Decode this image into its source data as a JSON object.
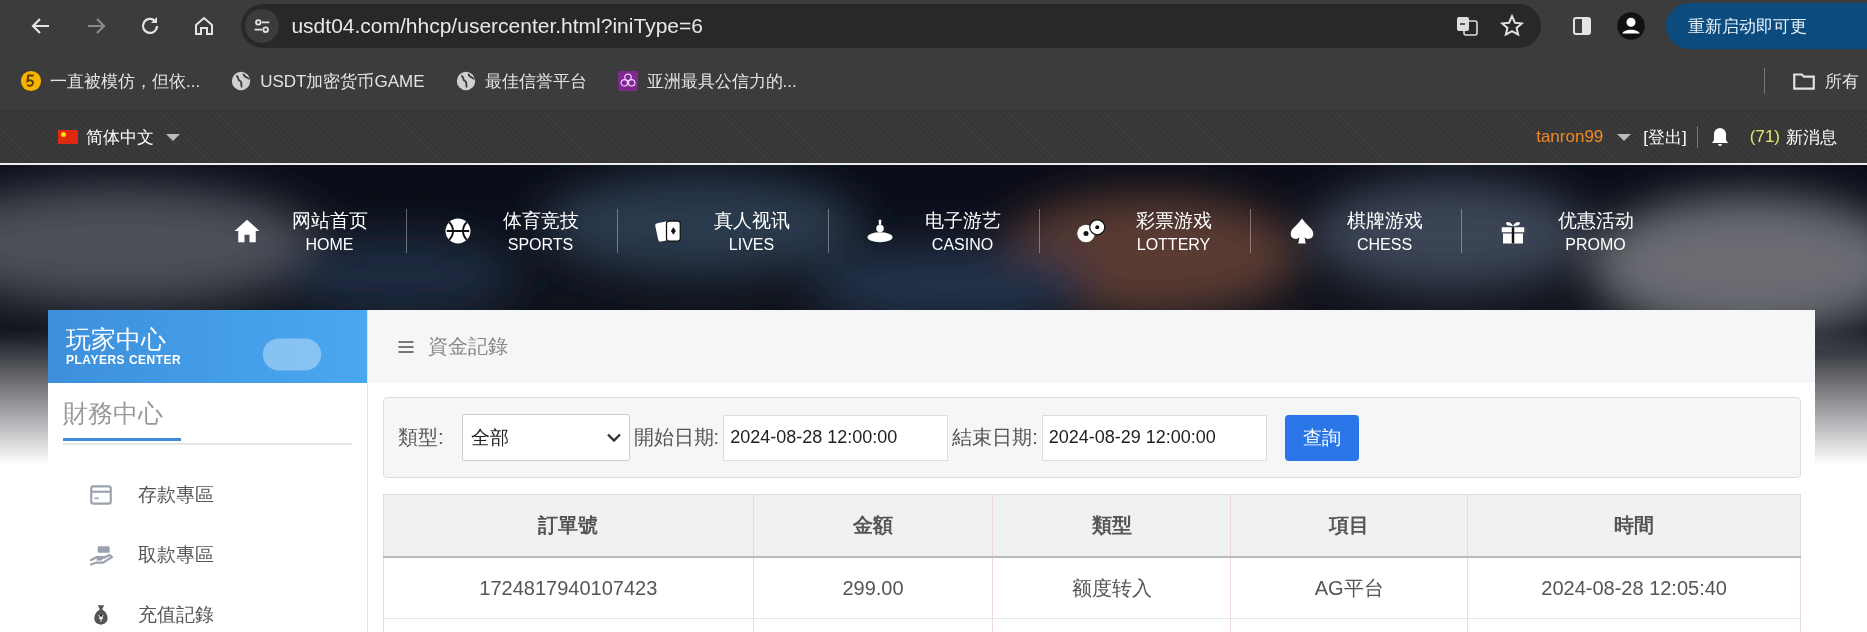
{
  "browser": {
    "url": "usdt04.com/hhcp/usercenter.html?iniType=6",
    "update_button": "重新启动即可更",
    "bookmarks": [
      {
        "label": "一直被模仿，但依..."
      },
      {
        "label": "USDT加密货币GAME"
      },
      {
        "label": "最佳信誉平台"
      },
      {
        "label": "亚洲最具公信力的..."
      }
    ],
    "bookmarks_folder": "所有"
  },
  "top_bar": {
    "language": "简体中文",
    "username": "tanron99",
    "logout": "[登出]",
    "message_count": "(71)",
    "messages": "新消息"
  },
  "nav": [
    {
      "title": "网站首页",
      "subtitle": "HOME"
    },
    {
      "title": "体育竞技",
      "subtitle": "SPORTS"
    },
    {
      "title": "真人视讯",
      "subtitle": "LIVES"
    },
    {
      "title": "电子游艺",
      "subtitle": "CASINO"
    },
    {
      "title": "彩票游戏",
      "subtitle": "LOTTERY"
    },
    {
      "title": "棋牌游戏",
      "subtitle": "CHESS"
    },
    {
      "title": "优惠活动",
      "subtitle": "PROMO"
    }
  ],
  "sidebar": {
    "title": "玩家中心",
    "subtitle": "PLAYERS CENTER",
    "section": "財務中心",
    "items": [
      {
        "label": "存款專區"
      },
      {
        "label": "取款專區"
      },
      {
        "label": "充值記錄"
      }
    ]
  },
  "content": {
    "breadcrumb": "資金記錄",
    "filter": {
      "type_label": "類型:",
      "type_value": "全部",
      "start_label": "開始日期:",
      "start_value": "2024-08-28 12:00:00",
      "end_label": "結束日期:",
      "end_value": "2024-08-29 12:00:00",
      "button": "查詢"
    },
    "table": {
      "columns": [
        "訂單號",
        "金額",
        "類型",
        "項目",
        "時間"
      ],
      "rows": [
        [
          "1724817940107423",
          "299.00",
          "额度转入",
          "AG平台",
          "2024-08-28 12:05:40"
        ]
      ]
    }
  }
}
